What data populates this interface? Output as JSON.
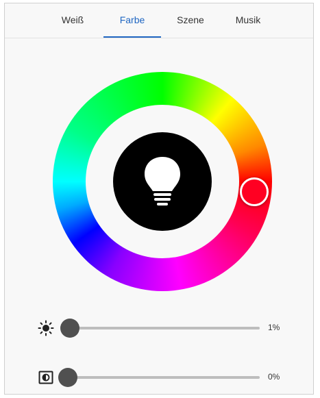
{
  "tabs": [
    {
      "label": "Weiß",
      "active": false
    },
    {
      "label": "Farbe",
      "active": true
    },
    {
      "label": "Szene",
      "active": false
    },
    {
      "label": "Musik",
      "active": false
    }
  ],
  "color_wheel": {
    "selected_color": "#ff0022",
    "center_icon": "lightbulb-icon"
  },
  "brightness": {
    "icon": "sun-icon",
    "value": 0.01,
    "label": "1%"
  },
  "saturation": {
    "icon": "contrast-icon",
    "value": 0.0,
    "label": "0%"
  },
  "colors": {
    "accent": "#1f66c2",
    "thumb": "#505050",
    "track": "#bdbdbd"
  }
}
